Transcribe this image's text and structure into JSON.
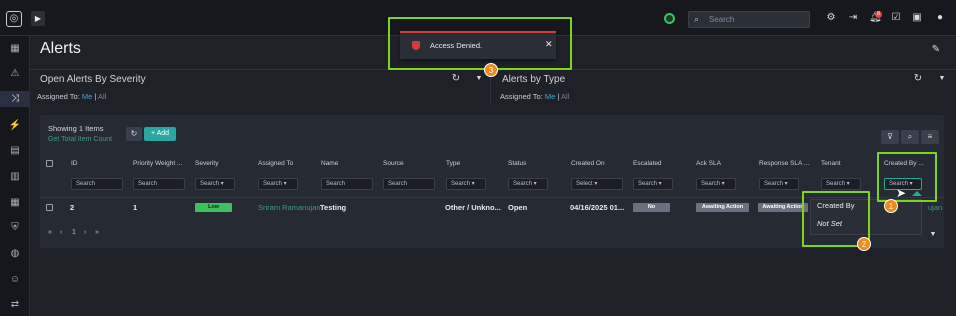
{
  "topbar": {
    "search_placeholder": "Search",
    "notification_count": "8"
  },
  "page": {
    "title": "Alerts"
  },
  "panels": [
    {
      "title": "Open Alerts By Severity",
      "assigned_label": "Assigned To:",
      "me": "Me",
      "sep": "|",
      "all": "All"
    },
    {
      "title": "Alerts by Type",
      "assigned_label": "Assigned To:",
      "me": "Me",
      "sep": "|",
      "all": "All"
    }
  ],
  "grid": {
    "showing": "Showing 1 Items",
    "get_total": "Get Total Item Count",
    "add_label": "+ Add",
    "columns": [
      "ID",
      "Priority Weight ...",
      "Severity",
      "Assigned To",
      "Name",
      "Source",
      "Type",
      "Status",
      "Created On",
      "Escalated",
      "Ack SLA",
      "Response SLA ...",
      "Tenant",
      "Created By ..."
    ],
    "filters": [
      "Search",
      "Search",
      "Search",
      "Search",
      "Search",
      "Search",
      "Search",
      "Search",
      "Select",
      "Search",
      "Search",
      "Search",
      "Search",
      "Search"
    ],
    "row": {
      "id": "2",
      "priority": "1",
      "severity": "Low",
      "assigned_to": "Sriram Ramanujan",
      "name": "Testing",
      "type": "Other / Unkno...",
      "status": "Open",
      "created_on": "04/16/2025 01...",
      "escalated": "No",
      "ack_sla": "Awaiting Action",
      "response_sla": "Awaiting Action",
      "created_by_partial": "ujan"
    },
    "pager": {
      "page": "1"
    }
  },
  "toast": {
    "message": "Access Denied."
  },
  "dropdown": {
    "items": [
      "Created By",
      "Not Set"
    ]
  },
  "steps": [
    "1",
    "2",
    "3"
  ],
  "colors": {
    "accent": "#2aa7a0",
    "highlight": "#7dd421",
    "step": "#f08a1c",
    "error": "#d43c3c",
    "low": "#3fbf5f"
  }
}
